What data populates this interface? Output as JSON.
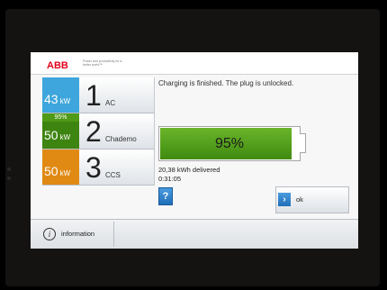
{
  "header": {
    "brand": "ABB",
    "tagline": "Power and productivity for a better world™"
  },
  "colors": {
    "ac": "#3ea6dc",
    "chademo": "#4f9a16",
    "ccs": "#e08a14",
    "brand_red": "#e2001a",
    "battery_green": "#4f9a16",
    "button_blue": "#2b84cf"
  },
  "connectors": [
    {
      "power": "43",
      "unit": "kW",
      "number": "1",
      "type": "AC",
      "color": "#3ea6dc"
    },
    {
      "power": "50",
      "unit": "kW",
      "number": "2",
      "type": "Chademo",
      "color": "#4f9a16",
      "percent": "95%"
    },
    {
      "power": "50",
      "unit": "kW",
      "number": "3",
      "type": "CCS",
      "color": "#e08a14"
    }
  ],
  "status": {
    "message": "Charging is finished. The plug is unlocked.",
    "battery_percent": "95%",
    "battery_level": 0.95,
    "energy": "20,38 kWh delivered",
    "duration": "0:31:05"
  },
  "buttons": {
    "help": "?",
    "ok_arrow": "›",
    "ok": "ok",
    "info_icon": "i",
    "information": "information"
  },
  "icons": {
    "help": "question-icon",
    "ok": "chevron-right-icon",
    "info": "info-circle-icon"
  }
}
